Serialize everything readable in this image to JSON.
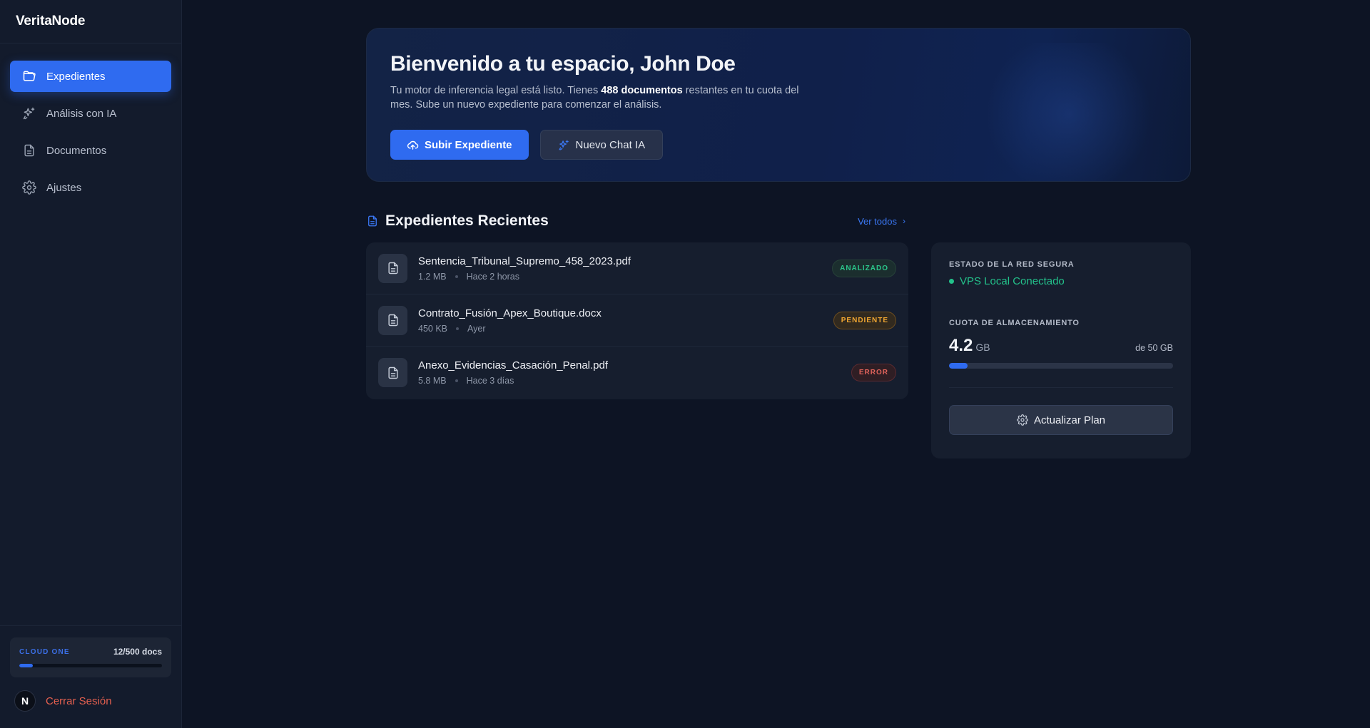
{
  "app": {
    "name": "VeritaNode"
  },
  "sidebar": {
    "items": [
      {
        "label": "Expedientes",
        "icon": "folder-open-icon",
        "active": true
      },
      {
        "label": "Análisis con IA",
        "icon": "sparkles-icon",
        "active": false
      },
      {
        "label": "Documentos",
        "icon": "document-icon",
        "active": false
      },
      {
        "label": "Ajustes",
        "icon": "gear-icon",
        "active": false
      }
    ],
    "plan": {
      "name": "CLOUD ONE",
      "usage": "12/500 docs",
      "used": 12,
      "limit": 500
    },
    "user_initial": "N",
    "logout_label": "Cerrar Sesión"
  },
  "hero": {
    "title": "Bienvenido a tu espacio, John Doe",
    "desc_before": "Tu motor de inferencia legal está listo. Tienes ",
    "desc_bold": "488 documentos",
    "desc_after": " restantes en tu cuota del mes. Sube un nuevo expediente para comenzar el análisis.",
    "primary_button": "Subir Expediente",
    "secondary_button": "Nuevo Chat IA"
  },
  "recent": {
    "title": "Expedientes Recientes",
    "see_all": "Ver todos",
    "files": [
      {
        "name": "Sentencia_Tribunal_Supremo_458_2023.pdf",
        "size": "1.2 MB",
        "time": "Hace 2 horas",
        "status": "ANALIZADO",
        "status_type": "ok"
      },
      {
        "name": "Contrato_Fusión_Apex_Boutique.docx",
        "size": "450 KB",
        "time": "Ayer",
        "status": "PENDIENTE",
        "status_type": "pending"
      },
      {
        "name": "Anexo_Evidencias_Casación_Penal.pdf",
        "size": "5.8 MB",
        "time": "Hace 3 días",
        "status": "ERROR",
        "status_type": "error"
      }
    ]
  },
  "status_card": {
    "network_label": "ESTADO DE LA RED SEGURA",
    "network_status": "VPS Local Conectado",
    "storage_label": "CUOTA DE ALMACENAMIENTO",
    "storage_used": "4.2",
    "storage_unit": "GB",
    "storage_total": "de 50 GB",
    "storage_fraction": 0.084,
    "upgrade_button": "Actualizar Plan"
  },
  "colors": {
    "accent": "#2f6bf0",
    "success": "#23c28b",
    "warning": "#f0a631",
    "danger": "#e0635b",
    "logout": "#e5604f"
  }
}
